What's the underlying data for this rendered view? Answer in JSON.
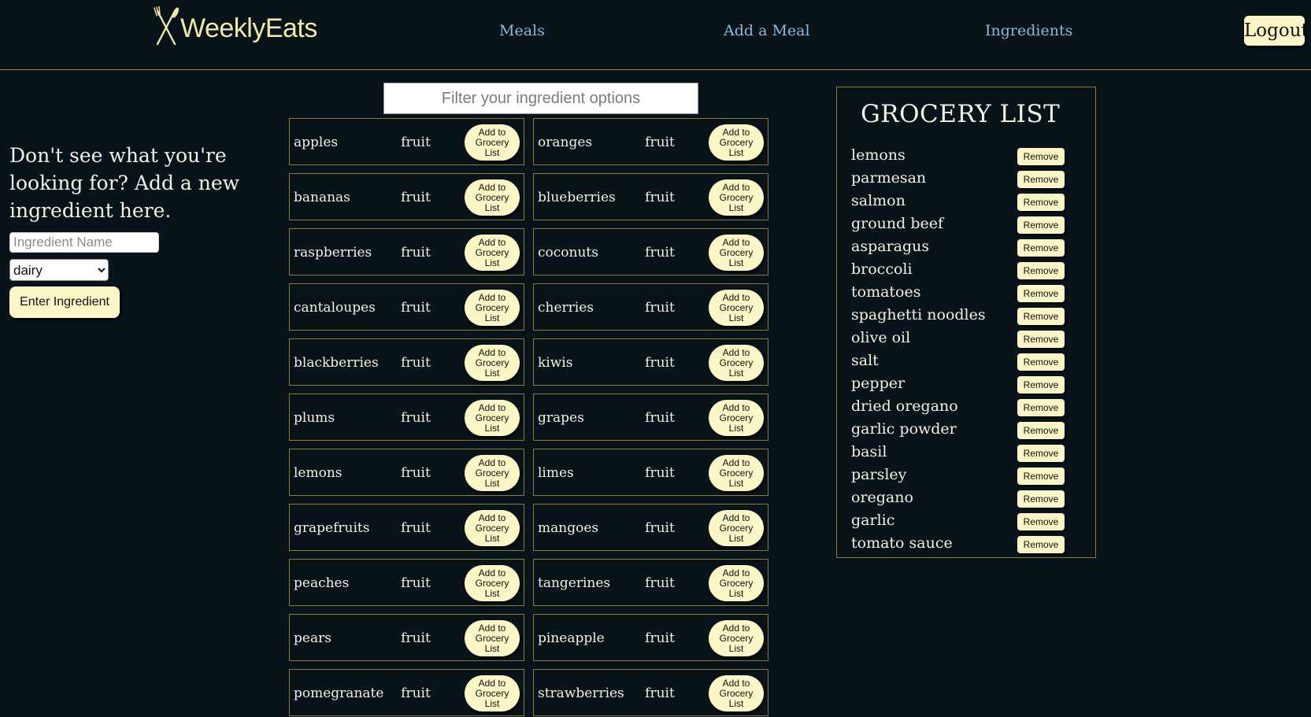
{
  "header": {
    "logo_text": "WeeklyEats",
    "nav": [
      {
        "label": "Meals"
      },
      {
        "label": "Add a Meal"
      },
      {
        "label": "Ingredients"
      }
    ],
    "logout_label": "Logout"
  },
  "add_ingredient": {
    "heading": "Don't see what you're looking for? Add a new ingredient here.",
    "name_placeholder": "Ingredient Name",
    "category_selected": "dairy",
    "submit_label": "Enter Ingredient"
  },
  "filter": {
    "placeholder": "Filter your ingredient options"
  },
  "ingredients": [
    {
      "name": "apples",
      "category": "fruit",
      "button": "Add to Grocery List"
    },
    {
      "name": "oranges",
      "category": "fruit",
      "button": "Add to Grocery List"
    },
    {
      "name": "bananas",
      "category": "fruit",
      "button": "Add to Grocery List"
    },
    {
      "name": "blueberries",
      "category": "fruit",
      "button": "Add to Grocery List"
    },
    {
      "name": "raspberries",
      "category": "fruit",
      "button": "Add to Grocery List"
    },
    {
      "name": "coconuts",
      "category": "fruit",
      "button": "Add to Grocery List"
    },
    {
      "name": "cantaloupes",
      "category": "fruit",
      "button": "Add to Grocery List"
    },
    {
      "name": "cherries",
      "category": "fruit",
      "button": "Add to Grocery List"
    },
    {
      "name": "blackberries",
      "category": "fruit",
      "button": "Add to Grocery List"
    },
    {
      "name": "kiwis",
      "category": "fruit",
      "button": "Add to Grocery List"
    },
    {
      "name": "plums",
      "category": "fruit",
      "button": "Add to Grocery List"
    },
    {
      "name": "grapes",
      "category": "fruit",
      "button": "Add to Grocery List"
    },
    {
      "name": "lemons",
      "category": "fruit",
      "button": "Add to Grocery List"
    },
    {
      "name": "limes",
      "category": "fruit",
      "button": "Add to Grocery List"
    },
    {
      "name": "grapefruits",
      "category": "fruit",
      "button": "Add to Grocery List"
    },
    {
      "name": "mangoes",
      "category": "fruit",
      "button": "Add to Grocery List"
    },
    {
      "name": "peaches",
      "category": "fruit",
      "button": "Add to Grocery List"
    },
    {
      "name": "tangerines",
      "category": "fruit",
      "button": "Add to Grocery List"
    },
    {
      "name": "pears",
      "category": "fruit",
      "button": "Add to Grocery List"
    },
    {
      "name": "pineapple",
      "category": "fruit",
      "button": "Add to Grocery List"
    },
    {
      "name": "pomegranate",
      "category": "fruit",
      "button": "Add to Grocery List"
    },
    {
      "name": "strawberries",
      "category": "fruit",
      "button": "Add to Grocery List"
    }
  ],
  "grocery_list": {
    "title": "GROCERY LIST",
    "remove_label": "Remove",
    "items": [
      "lemons",
      "parmesan",
      "salmon",
      "ground beef",
      "asparagus",
      "broccoli",
      "tomatoes",
      "spaghetti noodles",
      "olive oil",
      "salt",
      "pepper",
      "dried oregano",
      "garlic powder",
      "basil",
      "parsley",
      "oregano",
      "garlic",
      "tomato sauce"
    ]
  },
  "colors": {
    "background": "#08131a",
    "accent_button": "#fbf6c6",
    "nav_link": "#8fb8d6",
    "border_gold": "#8a7a3a"
  }
}
